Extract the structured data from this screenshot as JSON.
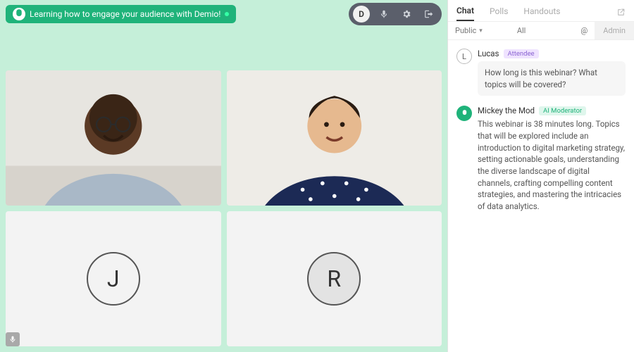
{
  "header": {
    "title": "Learning how to engage your audience with Demio!",
    "host_initial": "D"
  },
  "participants": {
    "tile3_initial": "J",
    "tile4_initial": "R"
  },
  "sidebar": {
    "tabs": {
      "chat": "Chat",
      "polls": "Polls",
      "handouts": "Handouts"
    },
    "filters": {
      "public": "Public",
      "all": "All",
      "at": "@",
      "admin": "Admin"
    }
  },
  "chat": {
    "m1": {
      "avatar": "L",
      "name": "Lucas",
      "badge": "Attendee",
      "text": "How long is this webinar? What topics will be covered?"
    },
    "m2": {
      "name": "Mickey the Mod",
      "badge": "AI Moderator",
      "text": "This webinar is 38 minutes long. Topics that will be explored include an introduction to digital marketing strategy, setting actionable goals, understanding the diverse landscape of digital channels, crafting compelling content strategies, and mastering the intricacies of data analytics."
    }
  }
}
